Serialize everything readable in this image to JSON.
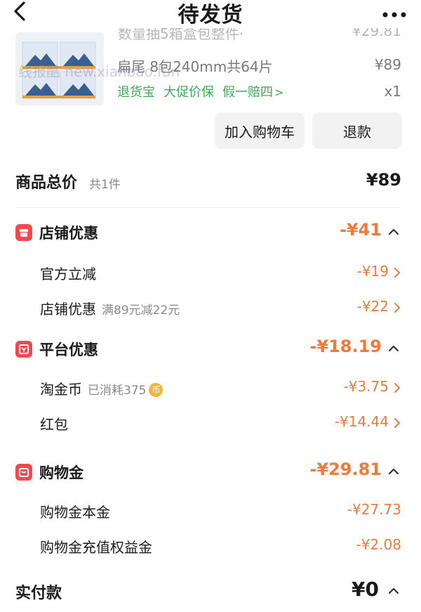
{
  "header": {
    "title": "待发货",
    "back_icon": "chevron-left-icon",
    "more_icon": "more-dots-icon"
  },
  "product": {
    "name_partial": "数量抽5箱盒包整件·",
    "price_partial": "¥29.81",
    "sku": "扁尾 8包240mm共64片",
    "price": "¥89",
    "tags": [
      "退货宝",
      "大促价保",
      "假一赔四"
    ],
    "tag_arrow": ">",
    "quantity": "x1",
    "watermark": "线报酷 new.xianbao.fun"
  },
  "actions": {
    "add_to_cart": "加入购物车",
    "refund": "退款"
  },
  "summary": {
    "total_label": "商品总价",
    "total_count": "共1件",
    "total_value": "¥89"
  },
  "store_discount": {
    "label": "店铺优惠",
    "value": "-¥41",
    "items": [
      {
        "label": "官方立减",
        "note": "",
        "value": "-¥19"
      },
      {
        "label": "店铺优惠",
        "note": "满89元减22元",
        "value": "-¥22"
      }
    ]
  },
  "platform_discount": {
    "label": "平台优惠",
    "value": "-¥18.19",
    "items": [
      {
        "label": "淘金币",
        "note": "已消耗375",
        "coin": "币",
        "value": "-¥3.75"
      },
      {
        "label": "红包",
        "note": "",
        "value": "-¥14.44"
      }
    ]
  },
  "shopping_credit": {
    "label": "购物金",
    "value": "-¥29.81",
    "items": [
      {
        "label": "购物金本金",
        "value": "-¥27.73"
      },
      {
        "label": "购物金充值权益金",
        "value": "-¥2.08"
      }
    ]
  },
  "payment": {
    "label": "实付款",
    "value": "¥0"
  },
  "colors": {
    "accent": "#f07a3c",
    "green": "#3bac57",
    "icon_red": "#f04950"
  }
}
